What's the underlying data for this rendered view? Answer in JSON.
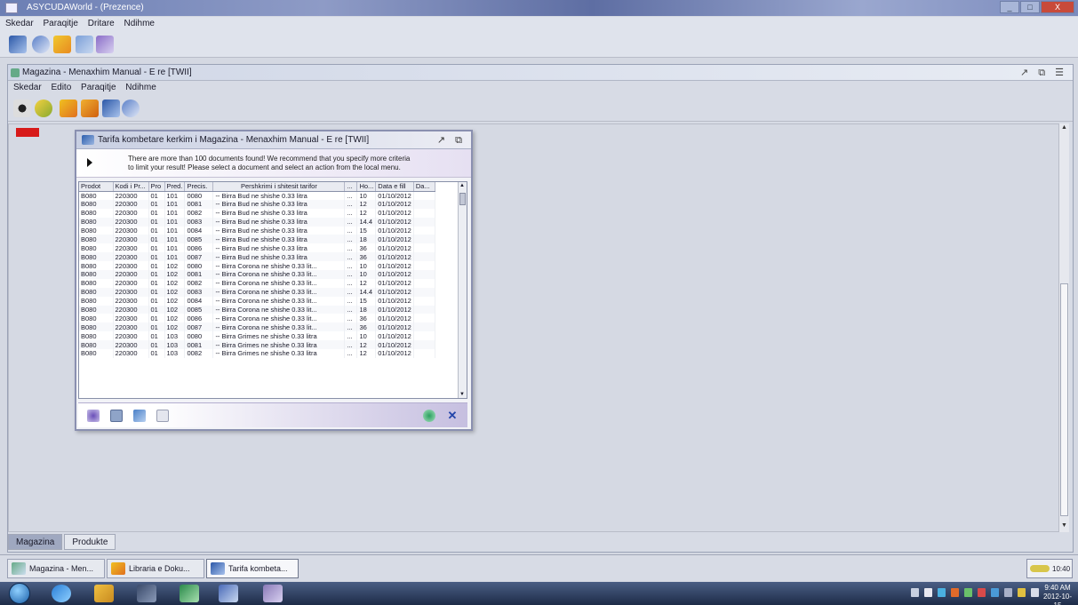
{
  "outer_window": {
    "title": "ASYCUDAWorld - (Prezence)",
    "menu": [
      "Skedar",
      "Paraqitje",
      "Dritare",
      "Ndihme"
    ],
    "buttons": [
      "_",
      "□",
      "X"
    ]
  },
  "inner_frame": {
    "title": "Magazina - Menaxhim Manual - E re [TWII]",
    "menu": [
      "Skedar",
      "Edito",
      "Paraqitje",
      "Ndihme"
    ],
    "controls": "↗ ⧉ ☰",
    "tabs": [
      "Magazina",
      "Produkte"
    ]
  },
  "dialog": {
    "title": "Tarifa kombetare kerkim i Magazina - Menaxhim Manual - E re [TWII]",
    "controls": "↗ ⧉",
    "message_line1": "There are more than 100 documents found! We recommend that you specify more criteria",
    "message_line2": "to limit your result! Please select a document and select an action from the local menu.",
    "columns": [
      "Prodot",
      "Kodi i Pr...",
      "Pro",
      "Pred.",
      "Precis.",
      "Pershkrimi i shitesit tarifor",
      "...",
      "Ho...",
      "Data e fill",
      "Da..."
    ],
    "rows": [
      [
        "B080",
        "220300",
        "01",
        "101",
        "0080",
        "-- Birra Bud ne shishe 0.33 litra",
        "...",
        "10",
        "01/10/2012",
        ""
      ],
      [
        "B080",
        "220300",
        "01",
        "101",
        "0081",
        "-- Birra Bud ne shishe 0.33 litra",
        "...",
        "12",
        "01/10/2012",
        ""
      ],
      [
        "B080",
        "220300",
        "01",
        "101",
        "0082",
        "-- Birra Bud ne shishe 0.33 litra",
        "...",
        "12",
        "01/10/2012",
        ""
      ],
      [
        "B080",
        "220300",
        "01",
        "101",
        "0083",
        "-- Birra Bud ne shishe 0.33 litra",
        "...",
        "14.4",
        "01/10/2012",
        ""
      ],
      [
        "B080",
        "220300",
        "01",
        "101",
        "0084",
        "-- Birra Bud ne shishe 0.33 litra",
        "...",
        "15",
        "01/10/2012",
        ""
      ],
      [
        "B080",
        "220300",
        "01",
        "101",
        "0085",
        "-- Birra Bud ne shishe 0.33 litra",
        "...",
        "18",
        "01/10/2012",
        ""
      ],
      [
        "B080",
        "220300",
        "01",
        "101",
        "0086",
        "-- Birra Bud ne shishe 0.33 litra",
        "...",
        "36",
        "01/10/2012",
        ""
      ],
      [
        "B080",
        "220300",
        "01",
        "101",
        "0087",
        "-- Birra Bud ne shishe 0.33 litra",
        "...",
        "36",
        "01/10/2012",
        ""
      ],
      [
        "B080",
        "220300",
        "01",
        "102",
        "0080",
        "-- Birra Corona ne shishe 0.33 lit...",
        "...",
        "10",
        "01/10/2012",
        ""
      ],
      [
        "B080",
        "220300",
        "01",
        "102",
        "0081",
        "-- Birra Corona ne shishe 0.33 lit...",
        "...",
        "10",
        "01/10/2012",
        ""
      ],
      [
        "B080",
        "220300",
        "01",
        "102",
        "0082",
        "-- Birra Corona ne shishe 0.33 lit...",
        "...",
        "12",
        "01/10/2012",
        ""
      ],
      [
        "B080",
        "220300",
        "01",
        "102",
        "0083",
        "-- Birra Corona ne shishe 0.33 lit...",
        "...",
        "14.4",
        "01/10/2012",
        ""
      ],
      [
        "B080",
        "220300",
        "01",
        "102",
        "0084",
        "-- Birra Corona ne shishe 0.33 lit...",
        "...",
        "15",
        "01/10/2012",
        ""
      ],
      [
        "B080",
        "220300",
        "01",
        "102",
        "0085",
        "-- Birra Corona ne shishe 0.33 lit...",
        "...",
        "18",
        "01/10/2012",
        ""
      ],
      [
        "B080",
        "220300",
        "01",
        "102",
        "0086",
        "-- Birra Corona ne shishe 0.33 lit...",
        "...",
        "36",
        "01/10/2012",
        ""
      ],
      [
        "B080",
        "220300",
        "01",
        "102",
        "0087",
        "-- Birra Corona ne shishe 0.33 lit...",
        "...",
        "36",
        "01/10/2012",
        ""
      ],
      [
        "B080",
        "220300",
        "01",
        "103",
        "0080",
        "-- Birra Grimes ne shishe 0.33 litra",
        "...",
        "10",
        "01/10/2012",
        ""
      ],
      [
        "B080",
        "220300",
        "01",
        "103",
        "0081",
        "-- Birra Grimes ne shishe 0.33 litra",
        "...",
        "12",
        "01/10/2012",
        ""
      ],
      [
        "B080",
        "220300",
        "01",
        "103",
        "0082",
        "-- Birra Grimes ne shishe 0.33 litra",
        "...",
        "12",
        "01/10/2012",
        ""
      ]
    ]
  },
  "app_taskbar": {
    "items": [
      "Magazina - Men...",
      "Libraria e Doku...",
      "Tarifa kombeta..."
    ],
    "clock": "10:40"
  },
  "windows_taskbar": {
    "clock_time": "9:40 AM",
    "clock_date": "2012-10-15"
  },
  "colors": {
    "red_marker": "#d71a1a",
    "title_gradient": "#6c7fb4",
    "dialog_accent": "#c6bfe0"
  }
}
